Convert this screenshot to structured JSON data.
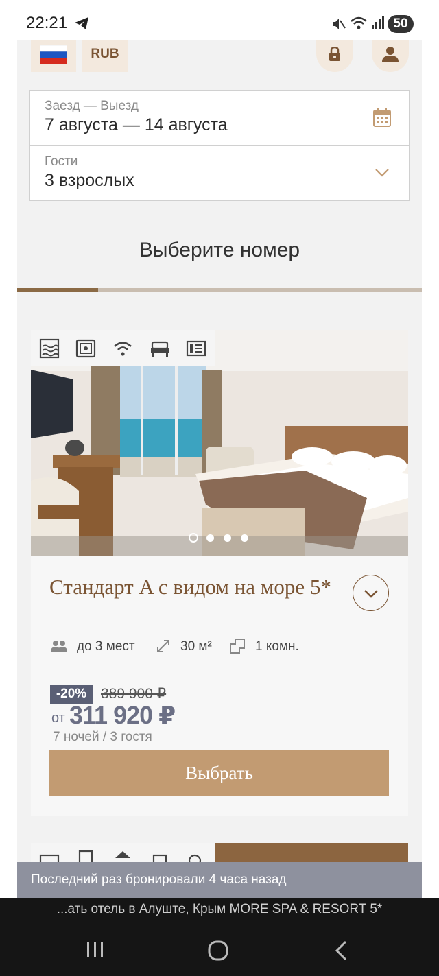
{
  "status_bar": {
    "time": "22:21",
    "battery": "50"
  },
  "header": {
    "currency": "RUB"
  },
  "booking": {
    "dates_label": "Заезд — Выезд",
    "dates_value": "7 августа — 14 августа",
    "guests_label": "Гости",
    "guests_value": "3 взрослых"
  },
  "section_title": "Выберите номер",
  "room": {
    "title": "Стандарт A с видом на море 5*",
    "capacity": "до 3 мест",
    "area": "30 м²",
    "rooms": "1 комн.",
    "discount": "-20%",
    "old_price": "389 900 ₽",
    "from_label": "от",
    "price": "311 920 ₽",
    "nights": "7 ночей / 3 гостя",
    "select_label": "Выбрать",
    "photo_count": 4,
    "active_photo": 1,
    "amenities": [
      "sea-view-icon",
      "safe-icon",
      "wifi-icon",
      "bed-icon",
      "tv-icon"
    ]
  },
  "toast": "Последний раз бронировали 4 часа назад",
  "browser": {
    "url_text": "...ать отель в Алуште, Крым MORE SPA & RESORT 5*"
  },
  "colors": {
    "brand_brown": "#7a5433",
    "button_tan": "#c29b72",
    "accent_tab": "#8b6a45",
    "price_slate": "#6b6f85"
  }
}
